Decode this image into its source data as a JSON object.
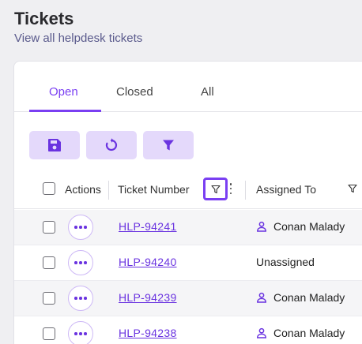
{
  "page": {
    "title": "Tickets",
    "subtitle": "View all helpdesk tickets"
  },
  "tabs": [
    {
      "label": "Open",
      "active": true
    },
    {
      "label": "Closed",
      "active": false
    },
    {
      "label": "All",
      "active": false
    }
  ],
  "toolbar": {
    "buttons": [
      "save-icon",
      "refresh-icon",
      "filter-icon"
    ]
  },
  "table": {
    "columns": {
      "actions": "Actions",
      "ticket_number": "Ticket Number",
      "assigned_to": "Assigned To"
    },
    "rows": [
      {
        "ticket": "HLP-94241",
        "assigned": "Conan Malady",
        "has_user_icon": true
      },
      {
        "ticket": "HLP-94240",
        "assigned": "Unassigned",
        "has_user_icon": false
      },
      {
        "ticket": "HLP-94239",
        "assigned": "Conan Malady",
        "has_user_icon": true
      },
      {
        "ticket": "HLP-94238",
        "assigned": "Conan Malady",
        "has_user_icon": true
      }
    ]
  },
  "colors": {
    "accent": "#7a3ff2",
    "button_bg": "#e4d9fb",
    "link": "#6a33e0"
  }
}
